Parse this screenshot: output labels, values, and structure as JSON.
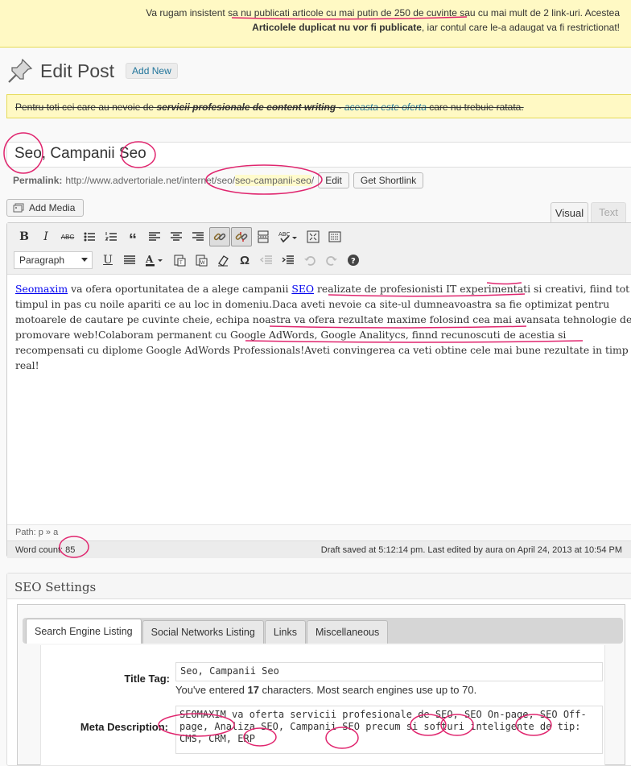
{
  "notice": {
    "line1_pre": "Va rugam insistent ",
    "line1_emph": "sa nu publicati articole cu mai putin de 250 de cuvinte",
    "line1_post": " sau cu mai mult de 2 link-uri. Acestea",
    "line2_bold": "Articolele duplicat nu vor fi publicate",
    "line2_post": ", iar contul care le-a adaugat va fi restrictionat!"
  },
  "header": {
    "title": "Edit Post",
    "add_new_label": "Add New",
    "icon": "pushpin-icon"
  },
  "update_nag": {
    "pre": "Pentru toti cei care au nevoie de ",
    "em": "servicii profesionale de content writing",
    "mid": " - ",
    "link": "aceasta este oferta",
    "post": " care nu trebuie ratata."
  },
  "post": {
    "title": "Seo, Campanii Seo",
    "permalink_label": "Permalink:",
    "permalink_base": "http://www.advertoriale.net/internet/seo/",
    "permalink_slug": "seo-campanii-seo",
    "permalink_trail": "/",
    "edit_label": "Edit",
    "shortlink_label": "Get Shortlink"
  },
  "editor": {
    "add_media_label": "Add Media",
    "tab_visual": "Visual",
    "tab_text": "Text",
    "format_value": "Paragraph",
    "toolbar_row1": [
      "bold-icon",
      "italic-icon",
      "strikethrough-icon",
      "bullet-list-icon",
      "numbered-list-icon",
      "blockquote-icon",
      "align-left-icon",
      "align-center-icon",
      "align-right-icon",
      "insert-link-icon",
      "remove-link-icon",
      "more-tag-icon",
      "spellcheck-icon",
      "fullscreen-icon",
      "kitchen-sink-icon"
    ],
    "toolbar_row2": [
      "underline-icon",
      "justify-icon",
      "text-color-icon",
      "paste-text-icon",
      "paste-word-icon",
      "clear-format-icon",
      "special-char-icon",
      "outdent-icon",
      "indent-icon",
      "undo-icon",
      "redo-icon",
      "help-icon"
    ],
    "content": {
      "link1": "Seomaxim",
      "t1": " va ofera oportunitatea de a alege campanii ",
      "link2": "SEO",
      "t2": " realizate de profesionisti IT experimentati si creativi, fiind tot timpul in pas cu noile apariti ce au loc in domeniu.Daca aveti nevoie ca site-ul dumneavoastra sa fie optimizat pentru motoarele de cautare pe cuvinte cheie, echipa noastra va ofera rezultate maxime folosind cea mai avansata tehnologie de promovare web!Colaboram permanent cu Google AdWords, Google Analitycs, finnd recunoscuti de acestia si recompensati cu diplome Google AdWords Professionals!Aveti convingerea ca veti obtine cele mai bune rezultate in timp real!"
    },
    "path": "Path: p » a",
    "word_count_label": "Word count: ",
    "word_count": "85",
    "draft_status": "Draft saved at 5:12:14 pm. Last edited by aura on April 24, 2013 at 10:54 PM"
  },
  "seo": {
    "box_title": "SEO Settings",
    "tabs": [
      "Search Engine Listing",
      "Social Networks Listing",
      "Links",
      "Miscellaneous"
    ],
    "title_tag_label": "Title Tag:",
    "title_tag_value": "Seo, Campanii Seo",
    "hint_pre": "You've entered ",
    "hint_count": "17",
    "hint_post": " characters. Most search engines use up to 70.",
    "meta_label": "Meta Description:",
    "meta_value": "SEOMAXIM va oferta servicii profesionale de SEO, SEO On-page, SEO Off-page, Analiza SEO, Campanii SEO precum si softuri inteligente de tip: CMS, CRM, ERP"
  },
  "colors": {
    "annotation": "#e0256e",
    "link": "#21759b",
    "notice_bg": "#fff9c4"
  }
}
